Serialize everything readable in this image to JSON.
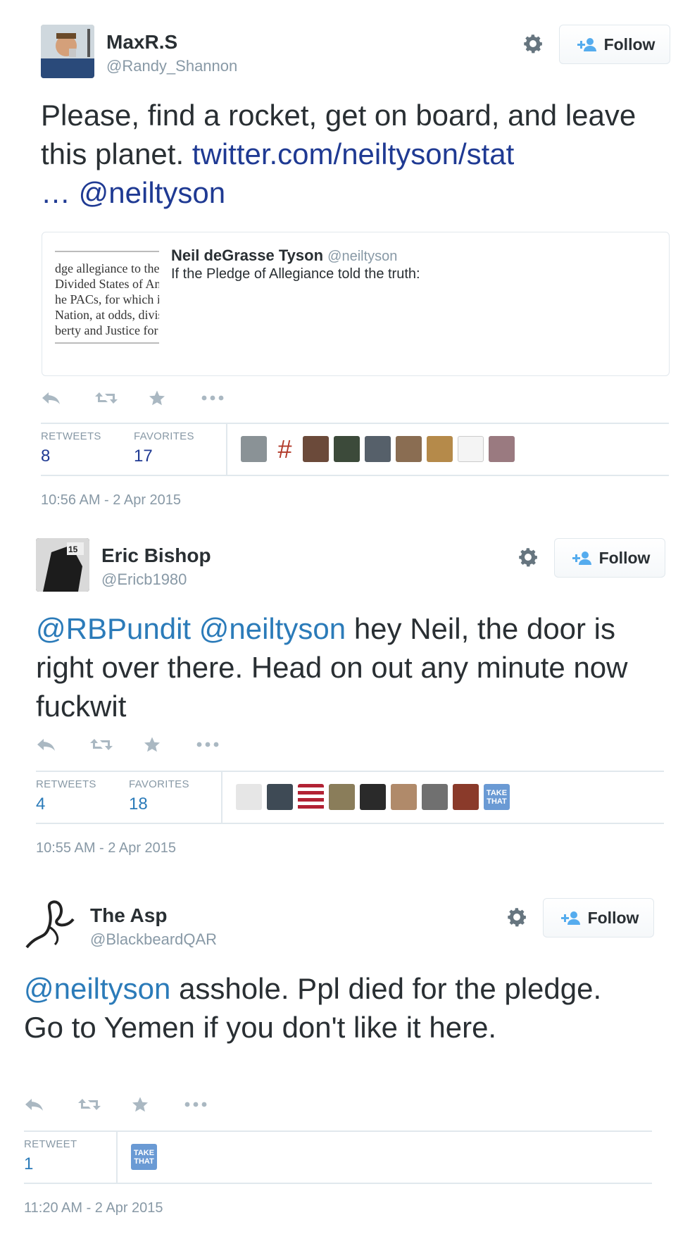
{
  "follow_label": "Follow",
  "tweets": [
    {
      "name": "MaxR.S",
      "handle": "@Randy_Shannon",
      "text": {
        "before": "Please, find a rocket, get on board, and leave this planet. ",
        "link": "twitter.com/neiltyson/stat",
        "ellipsis": " …",
        "mention": "@neiltyson"
      },
      "quote": {
        "name": "Neil deGrasse Tyson",
        "handle": "@neiltyson",
        "text": "If the Pledge of Allegiance told the truth:",
        "image_lines": [
          "dge allegiance to the",
          "Divided States of An",
          "he PACs, for which i",
          "Nation, at odds, divis",
          "berty and Justice for"
        ]
      },
      "stats": {
        "retweets_label": "RETWEETS",
        "retweets": "8",
        "favorites_label": "FAVORITES",
        "favorites": "17"
      },
      "time": "10:56 AM - 2 Apr 2015",
      "favoriter_avatars": [
        "#8a9296",
        "hash",
        "#6b4a3a",
        "#3c4a3a",
        "#56606a",
        "#8a6d52",
        "#b58a4a",
        "sketch",
        "#9a7a80"
      ]
    },
    {
      "name": "Eric Bishop",
      "handle": "@Ericb1980",
      "text": {
        "mention1": "@RBPundit",
        "mention2": "@neiltyson",
        "rest": " hey Neil, the door is right over there. Head on out any minute now fuckwit"
      },
      "stats": {
        "retweets_label": "RETWEETS",
        "retweets": "4",
        "favorites_label": "FAVORITES",
        "favorites": "18"
      },
      "time": "10:55 AM - 2 Apr 2015",
      "favoriter_avatars": [
        "#444",
        "#3e4a55",
        "flag",
        "#8a7d5a",
        "#2a2a2a",
        "#b08a6a",
        "#707070",
        "#8a3a2a",
        "takethat"
      ]
    },
    {
      "name": "The Asp",
      "handle": "@BlackbeardQAR",
      "text": {
        "mention": "@neiltyson",
        "rest": " asshole. Ppl died for the pledge. Go to Yemen if you don't like it here."
      },
      "stats": {
        "retweets_label": "RETWEET",
        "retweets": "1"
      },
      "time": "11:20 AM - 2 Apr 2015",
      "favoriter_avatars": [
        "takethat"
      ],
      "badge_text": "TAKE THAT"
    }
  ]
}
